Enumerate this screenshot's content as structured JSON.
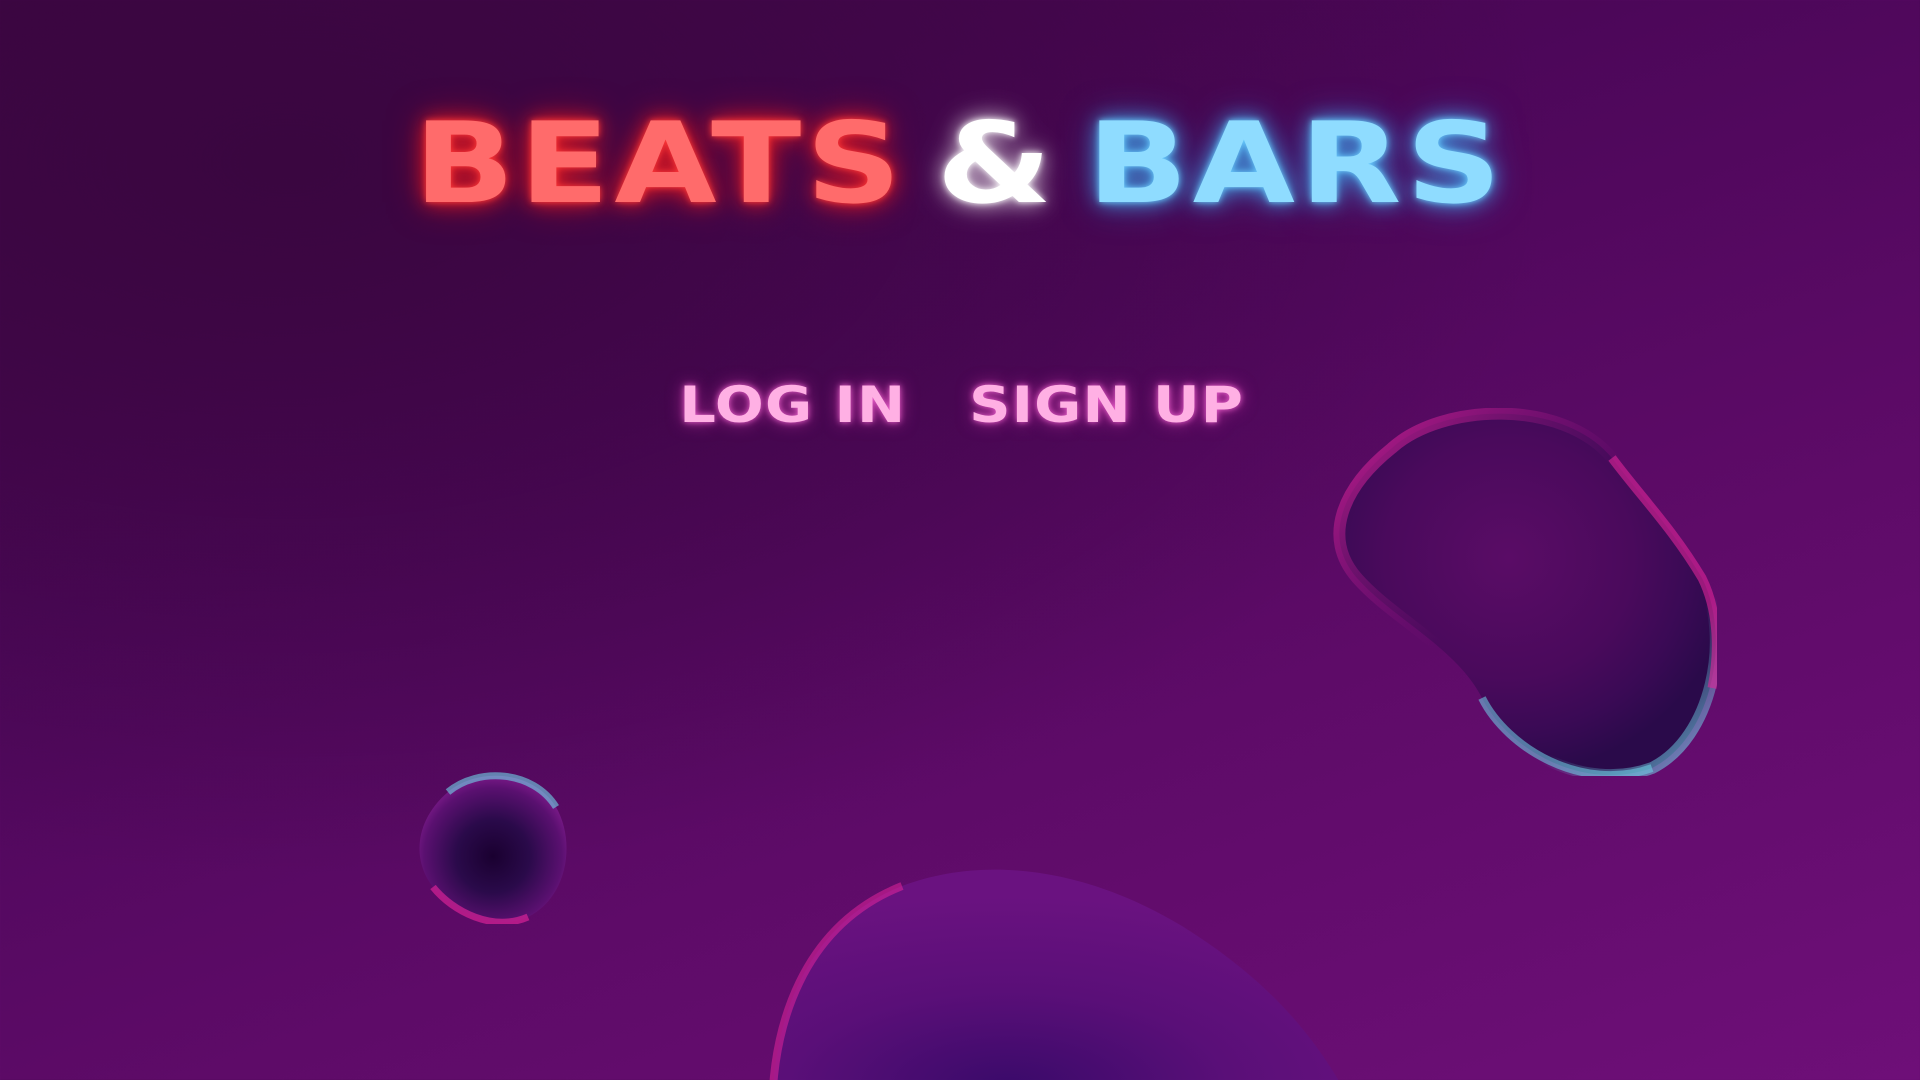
{
  "title": {
    "word1": "BEATS",
    "amp": "&",
    "word2": "BARS"
  },
  "nav": {
    "login_label": "LOG IN",
    "signup_label": "SIGN UP"
  },
  "colors": {
    "background": "#4d075a",
    "title_red": "#ff6b6b",
    "title_white": "#ffffff",
    "title_blue": "#8fdcff",
    "nav_pink": "#ffb0e4",
    "blob_magenta": "#e0249a",
    "blob_cyan": "#6fd3e8"
  }
}
